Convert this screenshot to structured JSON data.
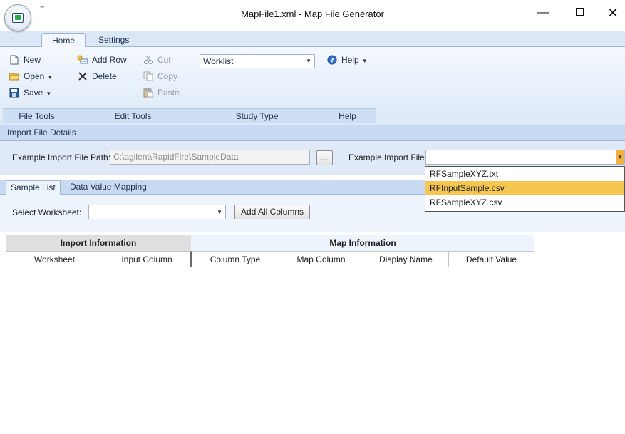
{
  "window": {
    "title": "MapFile1.xml - Map File Generator",
    "qat_label": "=",
    "minimize": "—",
    "close": "✕"
  },
  "ribbon": {
    "tabs": [
      {
        "label": "Home",
        "active": true
      },
      {
        "label": "Settings",
        "active": false
      }
    ],
    "groups": {
      "file_tools": {
        "label": "File Tools",
        "new": "New",
        "open": "Open",
        "save": "Save"
      },
      "edit_tools": {
        "label": "Edit Tools",
        "add_row": "Add Row",
        "delete": "Delete",
        "cut": "Cut",
        "copy": "Copy",
        "paste": "Paste"
      },
      "study_type": {
        "label": "Study Type",
        "selected": "Worklist"
      },
      "help": {
        "label": "Help",
        "help_button": "Help"
      }
    }
  },
  "import_details": {
    "section_title": "Import File Details",
    "path_label": "Example Import File Path:",
    "path_value": "C:\\agilent\\RapidFire\\SampleData",
    "browse_label": "...",
    "file_label": "Example Import File:",
    "file_value": "",
    "file_options": [
      {
        "label": "RFSampleXYZ.txt",
        "selected": false
      },
      {
        "label": "RFInputSample.csv",
        "selected": true
      },
      {
        "label": "RFSampleXYZ.csv",
        "selected": false
      }
    ]
  },
  "subtabs": [
    {
      "label": "Sample List",
      "active": true
    },
    {
      "label": "Data Value Mapping",
      "active": false
    }
  ],
  "worksheet": {
    "label": "Select Worksheet:",
    "value": "",
    "add_all_label": "Add All Columns"
  },
  "grid": {
    "group_headers": {
      "import": "Import Information",
      "map": "Map Information"
    },
    "columns": [
      "Worksheet",
      "Input Column",
      "Column Type",
      "Map Column",
      "Display Name",
      "Default Value"
    ]
  },
  "colors": {
    "ribbon_bg": "#dce8f8",
    "section_bg": "#c8daf1",
    "selected_item": "#f5c652",
    "dropdown_button": "#f2b13d"
  }
}
